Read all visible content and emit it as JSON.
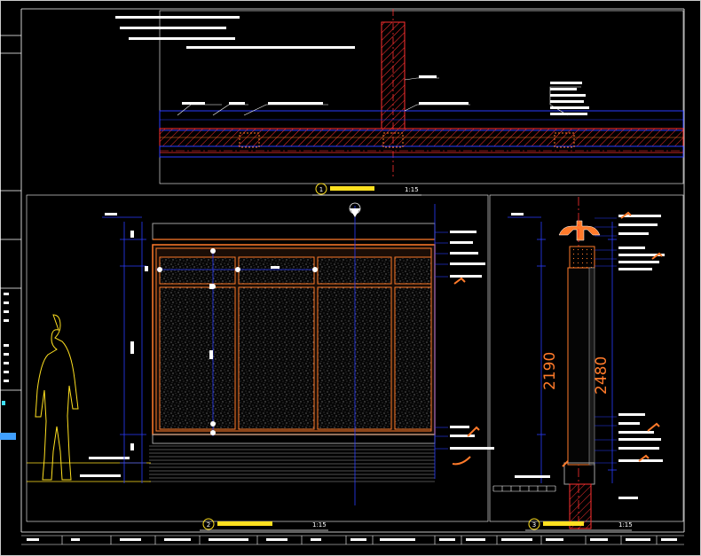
{
  "drawing": {
    "view1": {
      "number": "1",
      "scale": "1:15"
    },
    "view2": {
      "number": "2",
      "scale": "1:15"
    },
    "view3": {
      "number": "3",
      "scale": "1:15"
    },
    "dimensions": {
      "height_a": "2190",
      "height_b": "2480"
    }
  },
  "colors": {
    "background": "#000000",
    "frame": "#ffffff",
    "blue": "#2a3cff",
    "orange": "#ff7a2a",
    "red": "#ff3030",
    "yellow": "#ffe020",
    "gray": "#a0a0a0",
    "cyan": "#40e0ff"
  }
}
